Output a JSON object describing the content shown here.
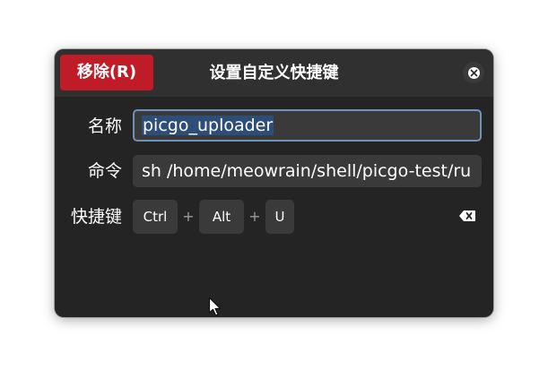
{
  "dialog": {
    "title": "设置自定义快捷键",
    "remove_label": "移除(R)"
  },
  "form": {
    "name_label": "名称",
    "name_value": "picgo_uploader",
    "command_label": "命令",
    "command_value": "sh /home/meowrain/shell/picgo-test/ru",
    "shortcut_label": "快捷键",
    "keys": [
      "Ctrl",
      "Alt",
      "U"
    ],
    "separator": "+"
  },
  "icons": {
    "close": "close-icon",
    "clear": "backspace-icon",
    "pointer": "mouse-pointer-icon"
  },
  "colors": {
    "accent_destructive": "#c01c28",
    "focus_border": "#6f90b8",
    "selection": "#2d4e78",
    "dialog_bg": "#242424"
  }
}
